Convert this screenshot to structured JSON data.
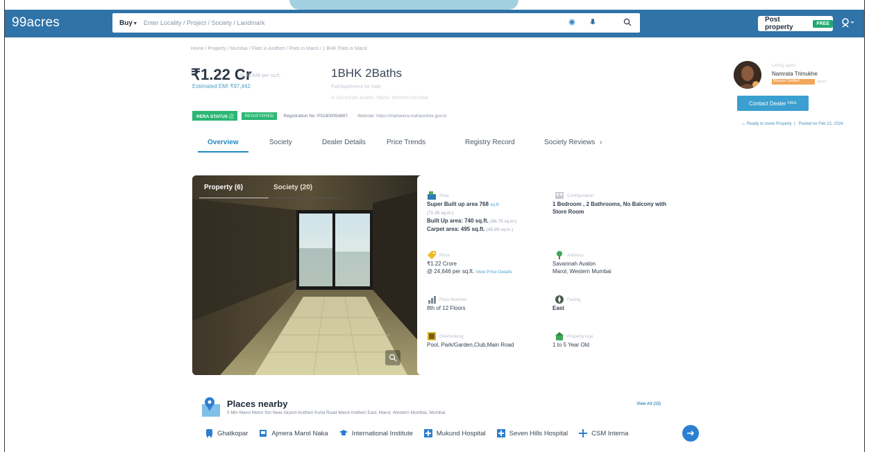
{
  "header": {
    "logo": "99acres",
    "search": {
      "buy_label": "Buy",
      "buy_chevron": "▾",
      "placeholder": "Enter Locality / Project / Society / Landmark"
    },
    "post_property": {
      "label": "Post property",
      "badge": "FREE"
    }
  },
  "breadcrumb": "Home / Property / Mumbai / Flats in Andheri / Flats in Marol / 1 BHK Flats in Marol",
  "listing": {
    "price": "₹1.22 Cr",
    "price_sub": "@ 24,646 per sq.ft.",
    "emi": "Estimated EMI ₹97,442",
    "title": "1BHK 2Baths",
    "title_sub1": "Flat/Apartment for Sale",
    "title_sub2": "in Savannah Avalon, Marol, Western Mumbai",
    "rera_status": "RERA STATUS",
    "rera_registered": "REGISTERED",
    "registration": "Registration No: P51800054887",
    "website": "Website: https://maharera.mahaonline.gov.in"
  },
  "tabs": [
    "Overview",
    "Society",
    "Dealer Details",
    "Price Trends",
    "Registry Record",
    "Society Reviews"
  ],
  "tabs_more": "›",
  "gallery": {
    "tab_property": "Property (6)",
    "tab_society": "Society (20)"
  },
  "details": {
    "area": {
      "label": "Area",
      "super": "Super Built up area 768",
      "super_unit": "sq.ft.",
      "super_muted": "(71.35 sq.m.)",
      "built": "Built Up area: 740 sq.ft.",
      "built_muted": "(68.75 sq.m.)",
      "carpet": "Carpet area: 495 sq.ft.",
      "carpet_muted": "(45.99 sq.m.)"
    },
    "configuration": {
      "label": "Configuration",
      "value": "1 Bedroom , 2 Bathrooms, No Balcony with Store Room"
    },
    "price": {
      "label": "Price",
      "value": "₹1.22 Crore",
      "per": "@ 24,646 per sq.ft.",
      "link": "View Price Details"
    },
    "address": {
      "label": "Address",
      "line1": "Savannah Avalon",
      "line2": "Marol, Western Mumbai"
    },
    "floor": {
      "label": "Floor Number",
      "value": "8th of 12 Floors"
    },
    "facing": {
      "label": "Facing",
      "value": "East"
    },
    "overlooking": {
      "label": "Overlooking",
      "value": "Pool, Park/Garden,Club,Main Road"
    },
    "property_age": {
      "label": "Property Age",
      "value": "1 to 5 Year Old"
    }
  },
  "agent": {
    "name": "Namrata Trimukhe",
    "sub": "Listing agent",
    "tag": "99acres Certified",
    "tag2": "Agent",
    "contact_label": "Contact Dealer",
    "contact_badge": "FREE",
    "ready": "Ready to move Property",
    "posted": "Posted on Feb 22, 2024"
  },
  "places": {
    "title": "Places nearby",
    "subtitle": "5 Min Marol Metro Stn Near Airport Andheri Kurla Road Marol Andheri East, Marol, Western Mumbai, Mumbai",
    "view_all": "View All (15)",
    "items": [
      "Ghatkopar",
      "Ajmera Marol Naka",
      "International Institute",
      "Mukund Hospital",
      "Seven Hills Hospital",
      "CSM Interna"
    ]
  },
  "colors": {
    "header_bg": "#2f73a8",
    "accent": "#1f8ac0",
    "rera_green": "#2bb673",
    "contact_btn": "#3b9fd0"
  }
}
